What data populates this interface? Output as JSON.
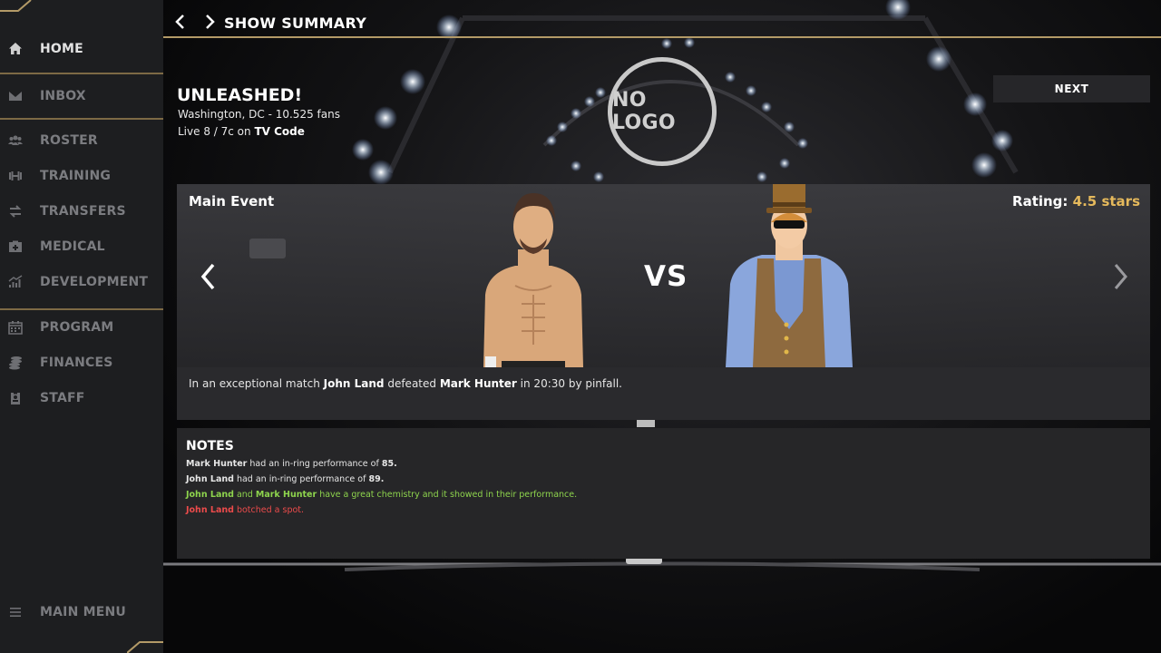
{
  "sidebar": {
    "items": [
      {
        "label": "HOME",
        "icon": "home-icon",
        "active": true
      },
      {
        "label": "INBOX",
        "icon": "mail-icon"
      },
      {
        "label": "ROSTER",
        "icon": "users-icon"
      },
      {
        "label": "TRAINING",
        "icon": "dumbbell-icon"
      },
      {
        "label": "TRANSFERS",
        "icon": "transfer-arrows-icon"
      },
      {
        "label": "MEDICAL",
        "icon": "medical-kit-icon"
      },
      {
        "label": "DEVELOPMENT",
        "icon": "chart-icon"
      },
      {
        "label": "PROGRAM",
        "icon": "calendar-icon"
      },
      {
        "label": "FINANCES",
        "icon": "coins-icon"
      },
      {
        "label": "STAFF",
        "icon": "badge-icon"
      }
    ],
    "main_menu": "MAIN MENU",
    "accent": "#b39a67"
  },
  "header": {
    "title": "SHOW SUMMARY"
  },
  "show": {
    "name": "UNLEASHED!",
    "location": "Washington, DC - 10.525 fans",
    "tv_prefix": "Live 8 / 7c on ",
    "tv_channel": "TV Code",
    "logo_text": "NO LOGO"
  },
  "next_button": "NEXT",
  "match": {
    "event_label": "Main Event",
    "rating_label": "Rating:",
    "rating_value": "4.5 stars",
    "vs": "VS",
    "result": {
      "pre": "In an exceptional match ",
      "winner": "John Land",
      "mid": " defeated ",
      "loser": "Mark Hunter",
      "post": " in 20:30 by pinfall."
    }
  },
  "notes": {
    "title": "NOTES",
    "lines": [
      {
        "name": "Mark Hunter",
        "text": " had an in-ring performance of ",
        "value": "85."
      },
      {
        "name": "John Land",
        "text": " had an in-ring performance of ",
        "value": "89."
      },
      {
        "name": "John Land",
        "mid": " and ",
        "name2": "Mark Hunter",
        "text": " have a great chemistry and it showed in their performance."
      },
      {
        "name": "John Land",
        "text": " botched a spot."
      }
    ]
  }
}
